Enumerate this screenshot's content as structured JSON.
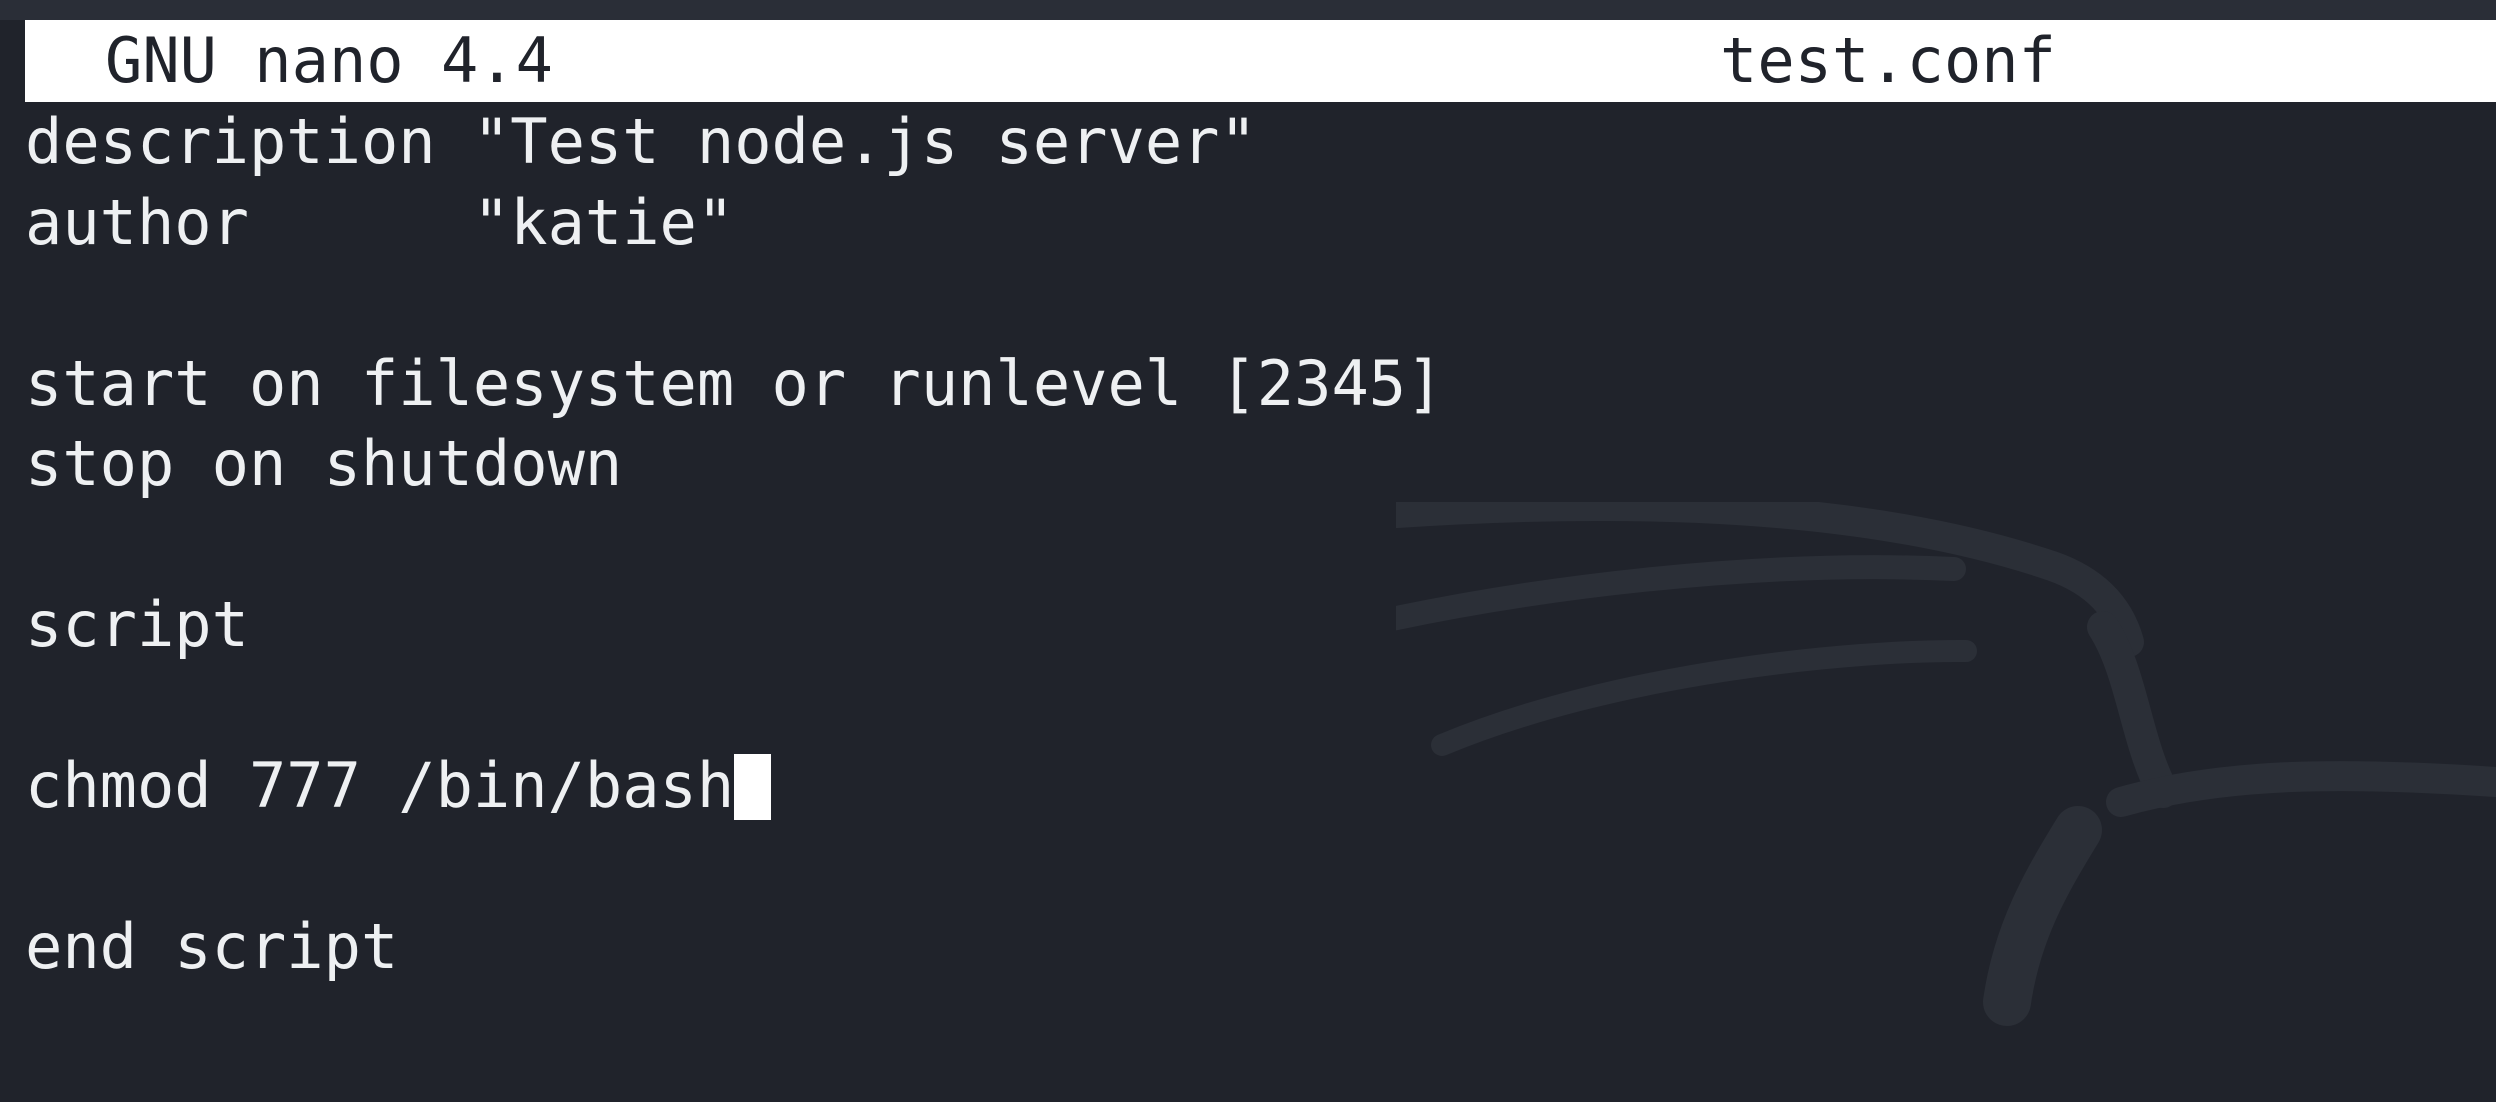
{
  "nano": {
    "version_label": "GNU nano 4.4",
    "filename": "test.conf",
    "lines": [
      "description \"Test node.js server\"",
      "author      \"katie\"",
      "",
      "start on filesystem or runlevel [2345]",
      "stop on shutdown",
      "",
      "script",
      "",
      "chmod 777 /bin/bash",
      "",
      "end script"
    ]
  },
  "colors": {
    "background": "#20232b",
    "text": "#eef0f2",
    "title_bar_bg": "#ffffff",
    "title_bar_text": "#20232b"
  },
  "icons": {
    "wallpaper": "kali-dragon-icon"
  }
}
